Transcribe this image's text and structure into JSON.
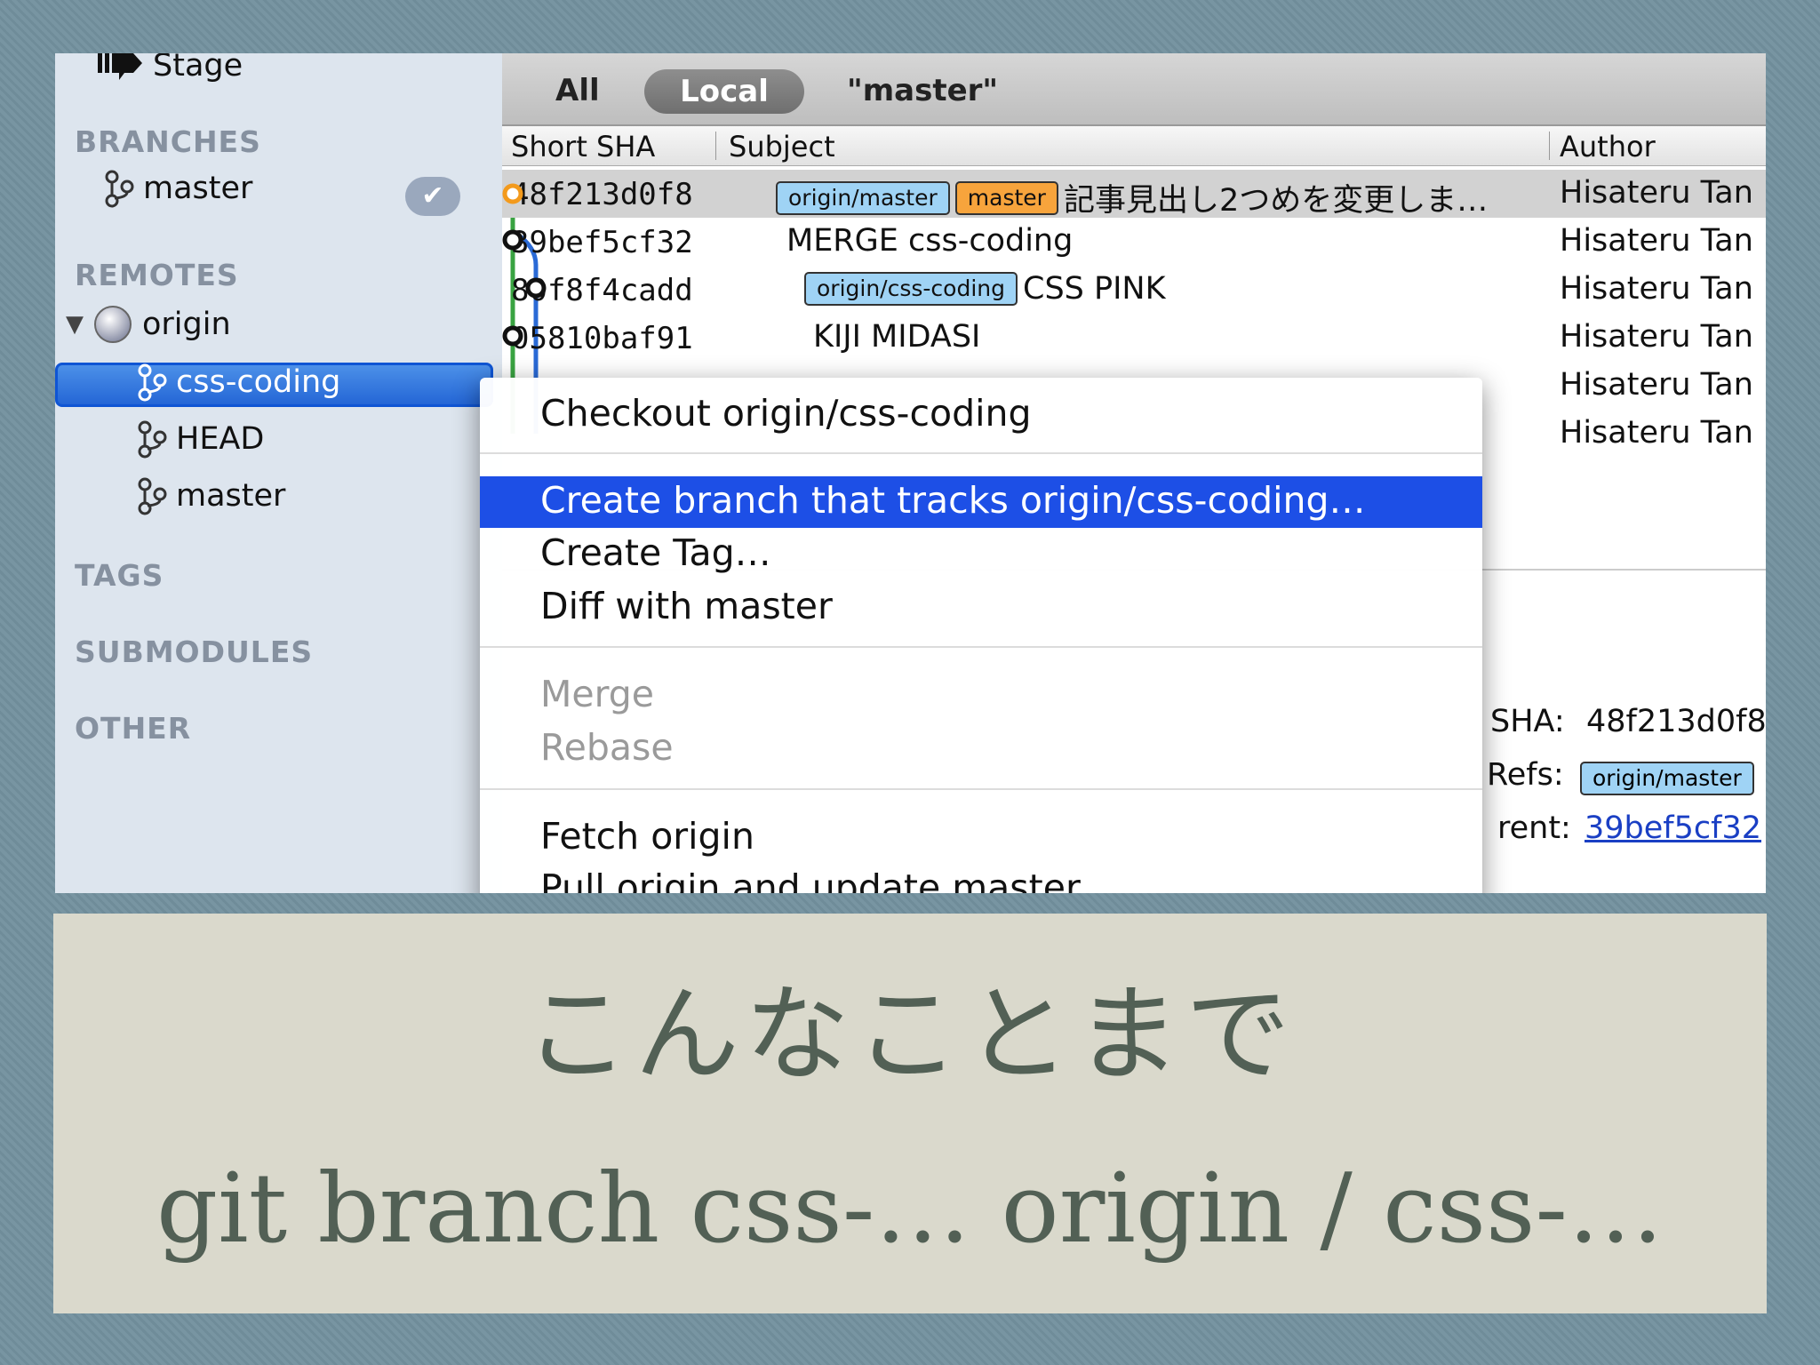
{
  "sidebar": {
    "stage_label": "Stage",
    "sections": {
      "branches": "BRANCHES",
      "remotes": "REMOTES",
      "tags": "TAGS",
      "submodules": "SUBMODULES",
      "other": "OTHER"
    },
    "branches": [
      {
        "label": "master",
        "checked": true
      }
    ],
    "remote_name": "origin",
    "remote_branches": [
      {
        "label": "css-coding",
        "selected": true
      },
      {
        "label": "HEAD"
      },
      {
        "label": "master"
      }
    ]
  },
  "toolbar": {
    "all": "All",
    "local": "Local",
    "master": "\"master\""
  },
  "columns": {
    "sha": "Short SHA",
    "subject": "Subject",
    "author": "Author"
  },
  "commits": [
    {
      "sha": "48f213d0f8",
      "refs": [
        "origin/master",
        "master"
      ],
      "subject": "記事見出し2つめを変更しま…",
      "author": "Hisateru Tan"
    },
    {
      "sha": "39bef5cf32",
      "refs": [],
      "subject": "MERGE css-coding",
      "author": "Hisateru Tan"
    },
    {
      "sha": "80f8f4cadd",
      "refs": [
        "origin/css-coding"
      ],
      "subject": "CSS PINK",
      "author": "Hisateru Tan"
    },
    {
      "sha": "05810baf91",
      "refs": [],
      "subject": "KIJI MIDASI",
      "author": "Hisateru Tan"
    },
    {
      "author": "Hisateru Tan"
    },
    {
      "author": "Hisateru Tan"
    }
  ],
  "detail": {
    "sha_label": "SHA:",
    "sha_value": "48f213d0f8",
    "refs_label": "Refs:",
    "refs_value": "origin/master",
    "parent_label": "rent:",
    "parent_value": "39bef5cf32"
  },
  "context_menu": {
    "items": [
      "Checkout origin/css-coding",
      "Create branch that tracks origin/css-coding…",
      "Create Tag…",
      "Diff with master",
      "Merge",
      "Rebase",
      "Fetch origin",
      "Pull origin and update master"
    ]
  },
  "caption": {
    "line1": "こんなことまで",
    "line2": "git branch css-… origin / css-…"
  },
  "colors": {
    "highlight": "#1d4fe6",
    "sidebar_bg": "#dde5ee",
    "caption_bg": "#dad9cc",
    "caption_text": "#526055",
    "tag_blue": "#9fd3f5",
    "tag_orange": "#f7a43c"
  }
}
